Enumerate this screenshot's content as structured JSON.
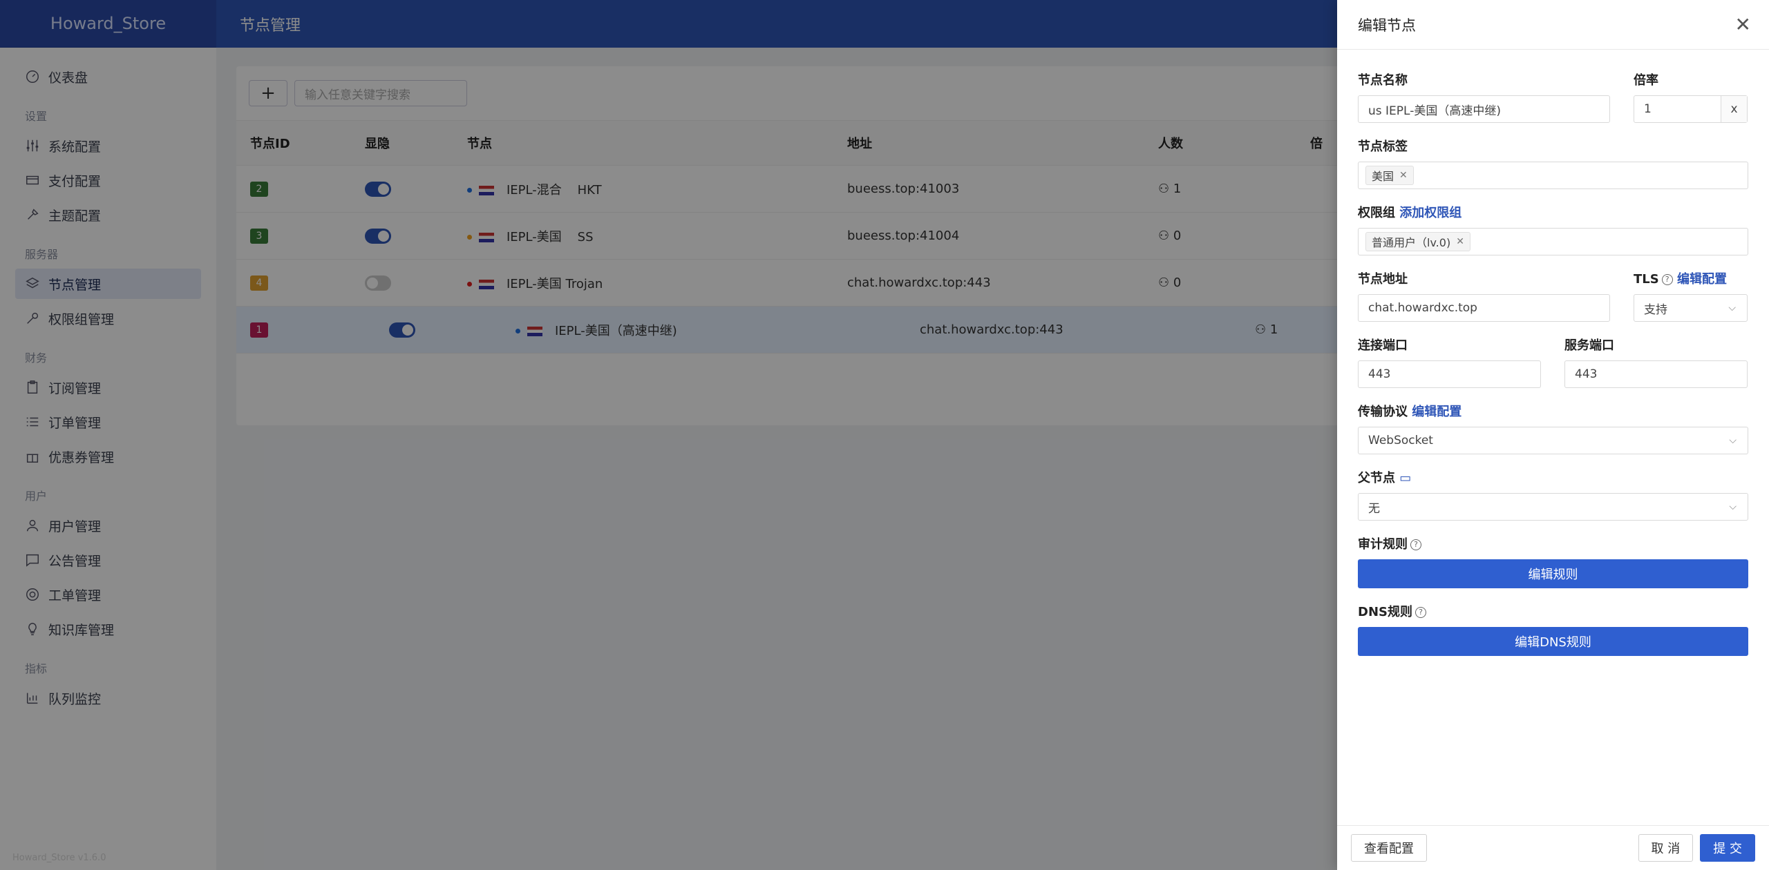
{
  "app": {
    "logo": "Howard_Store",
    "version": "Howard_Store v1.6.0",
    "page_title": "节点管理"
  },
  "sidebar": {
    "dashboard": "仪表盘",
    "groups": [
      {
        "title": "设置",
        "items": [
          "系统配置",
          "支付配置",
          "主题配置"
        ]
      },
      {
        "title": "服务器",
        "items": [
          "节点管理",
          "权限组管理"
        ]
      },
      {
        "title": "财务",
        "items": [
          "订阅管理",
          "订单管理",
          "优惠券管理"
        ]
      },
      {
        "title": "用户",
        "items": [
          "用户管理",
          "公告管理",
          "工单管理",
          "知识库管理"
        ]
      },
      {
        "title": "指标",
        "items": [
          "队列监控"
        ]
      }
    ]
  },
  "toolbar": {
    "add_label": "+",
    "search_placeholder": "输入任意关键字搜索"
  },
  "table": {
    "headers": [
      "节点ID",
      "显隐",
      "节点",
      "地址",
      "人数",
      "倍"
    ],
    "rows": [
      {
        "id": "2",
        "id_color": "#3a7d3a",
        "visible": true,
        "dot": "#1f6fe0",
        "name": "IEPL-混合",
        "proto": "HKT",
        "address": "bueess.top:41003",
        "users": "1"
      },
      {
        "id": "3",
        "id_color": "#3a7d3a",
        "visible": true,
        "dot": "#f0a020",
        "name": "IEPL-美国",
        "proto": "SS",
        "address": "bueess.top:41004",
        "users": "0"
      },
      {
        "id": "4",
        "id_color": "#e0a030",
        "visible": false,
        "dot": "#e02020",
        "name": "IEPL-美国 Trojan",
        "proto": "",
        "address": "chat.howardxc.top:443",
        "users": "0"
      },
      {
        "id": "1",
        "id_color": "#c0205a",
        "visible": true,
        "dot": "#1f6fe0",
        "name": "IEPL-美国（高速中继)",
        "proto": "",
        "address": "chat.howardxc.top:443",
        "users": "1"
      }
    ]
  },
  "drawer": {
    "title": "编辑节点",
    "name_label": "节点名称",
    "name_value": "us IEPL-美国（高速中继)",
    "rate_label": "倍率",
    "rate_value": "1",
    "rate_suffix": "x",
    "tags_label": "节点标签",
    "tag": "美国",
    "group_label": "权限组",
    "group_link": "添加权限组",
    "group_tag": "普通用户（lv.0)",
    "addr_label": "节点地址",
    "addr_value": "chat.howardxc.top",
    "tls_label": "TLS",
    "tls_link": "编辑配置",
    "tls_value": "支持",
    "port_label": "连接端口",
    "port_value": "443",
    "sport_label": "服务端口",
    "sport_value": "443",
    "proto_label": "传输协议",
    "proto_link": "编辑配置",
    "proto_value": "WebSocket",
    "parent_label": "父节点",
    "parent_value": "无",
    "audit_label": "审计规则",
    "audit_btn": "编辑规则",
    "dns_label": "DNS规则",
    "dns_btn": "编辑DNS规则",
    "view_config": "查看配置",
    "cancel": "取 消",
    "submit": "提 交"
  }
}
